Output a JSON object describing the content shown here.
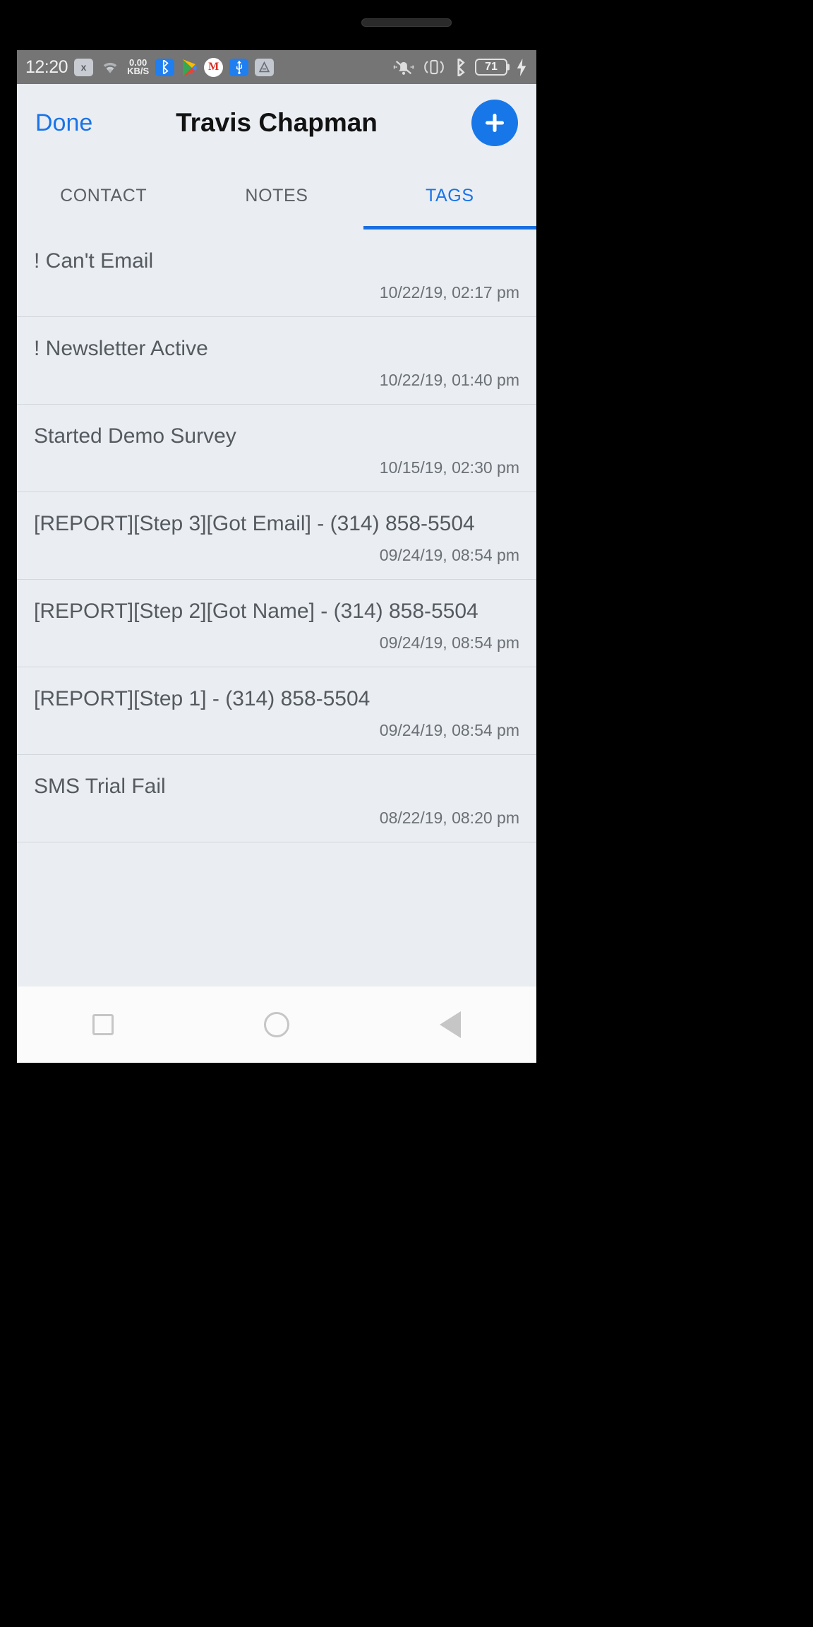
{
  "status_bar": {
    "time": "12:20",
    "network_speed_value": "0.00",
    "network_speed_unit": "KB/S",
    "battery_level": "71",
    "left_icons": [
      "clock",
      "sim-x-icon",
      "wifi-icon",
      "network-speed",
      "bluetooth-icon",
      "play-store-icon",
      "gmail-icon",
      "usb-icon",
      "androidauto-icon"
    ],
    "right_icons": [
      "mute-bell-icon",
      "vibrate-icon",
      "bluetooth-icon",
      "battery-icon",
      "charging-bolt-icon"
    ],
    "sim_label": "x"
  },
  "nav": {
    "done_label": "Done",
    "title": "Travis Chapman",
    "add_label": "+"
  },
  "tabs": [
    {
      "label": "CONTACT",
      "active": false
    },
    {
      "label": "NOTES",
      "active": false
    },
    {
      "label": "TAGS",
      "active": true
    }
  ],
  "tag_rows": [
    {
      "title": "! Can't Email",
      "date": "10/22/19, 02:17 pm"
    },
    {
      "title": "! Newsletter Active",
      "date": "10/22/19, 01:40 pm"
    },
    {
      "title": "Started Demo Survey",
      "date": "10/15/19, 02:30 pm"
    },
    {
      "title": "[REPORT][Step 3][Got Email] - (314) 858-5504",
      "date": "09/24/19, 08:54 pm"
    },
    {
      "title": "[REPORT][Step 2][Got Name] - (314) 858-5504",
      "date": "09/24/19, 08:54 pm"
    },
    {
      "title": "[REPORT][Step 1] - (314) 858-5504",
      "date": "09/24/19, 08:54 pm"
    },
    {
      "title": "SMS Trial Fail",
      "date": "08/22/19, 08:20 pm"
    }
  ],
  "android_nav": {
    "recents": "recents-square-icon",
    "home": "home-circle-icon",
    "back": "back-triangle-icon"
  },
  "colors": {
    "accent_blue": "#1a73e8",
    "fab_blue": "#1877e8",
    "screen_bg": "#eaeef2",
    "statusbar_bg": "#757575",
    "text_primary": "#121212",
    "text_secondary": "#545a60"
  }
}
